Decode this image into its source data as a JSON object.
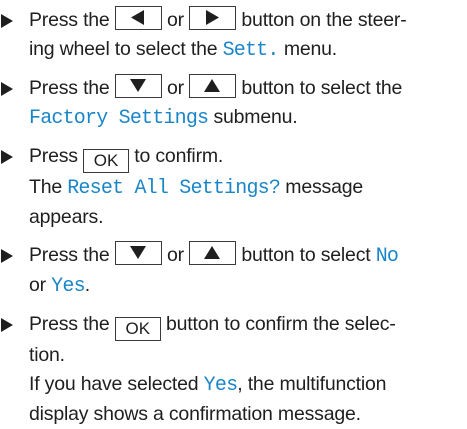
{
  "steps": [
    {
      "parts": {
        "t1": "Press the",
        "t2": "or",
        "t3": "button on the steer-",
        "t4": "ing wheel to select the",
        "hl1": "Sett.",
        "t5": "menu."
      }
    },
    {
      "parts": {
        "t1": "Press the",
        "t2": "or",
        "t3": "button to select the",
        "hl1": "Factory Settings",
        "t4": "submenu."
      }
    },
    {
      "parts": {
        "t1": "Press",
        "ok": "OK",
        "t2": "to confirm.",
        "t3": "The",
        "hl1": "Reset All Settings?",
        "t4": "message",
        "t5": "appears."
      }
    },
    {
      "parts": {
        "t1": "Press the",
        "t2": "or",
        "t3": "button to select",
        "hl1": "No",
        "t4": "or",
        "hl2": "Yes",
        "t5": "."
      }
    },
    {
      "parts": {
        "t1": "Press the",
        "ok": "OK",
        "t2": "button to confirm the selec-",
        "t3": "tion.",
        "t4": "If you have selected",
        "hl1": "Yes",
        "t5": ", the multifunction",
        "t6": "display shows a confirmation message."
      }
    }
  ],
  "style": {
    "highlight_color": "#1a86c7",
    "text_color": "#1f1f1f",
    "button_border_color": "#3a3a3a"
  },
  "icons": {
    "bullet": "triangle-right-icon",
    "left": "arrow-left-icon",
    "right": "arrow-right-icon",
    "down": "arrow-down-icon",
    "up": "arrow-up-icon"
  }
}
